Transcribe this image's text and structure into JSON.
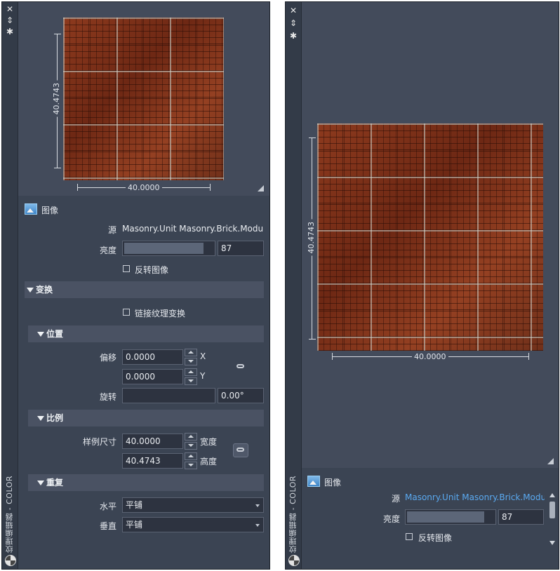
{
  "left_panel": {
    "palette_title": "纹理编辑器 - COLOR",
    "preview": {
      "width_label": "40.0000",
      "height_label": "40.4743"
    },
    "image_section": {
      "heading": "图像",
      "source_label": "源",
      "source_value": "Masonry.Unit Masonry.Brick.Modu",
      "brightness_label": "亮度",
      "brightness_value": "87",
      "brightness_fraction": 0.87,
      "invert_label": "反转图像",
      "invert_checked": false
    },
    "transform": {
      "heading": "变换",
      "link_transforms_label": "链接纹理变换",
      "link_transforms_checked": false,
      "position": {
        "heading": "位置",
        "offset_label": "偏移",
        "offset_x": "0.0000",
        "x_axis": "X",
        "offset_y": "0.0000",
        "y_axis": "Y",
        "rotation_label": "旋转",
        "rotation_value": "0.00°"
      },
      "scale": {
        "heading": "比例",
        "sample_size_label": "样例尺寸",
        "width_value": "40.0000",
        "width_label": "宽度",
        "height_value": "40.4743",
        "height_label": "高度"
      },
      "repeat": {
        "heading": "重复",
        "horizontal_label": "水平",
        "horizontal_value": "平铺",
        "vertical_label": "垂直",
        "vertical_value": "平铺"
      }
    }
  },
  "right_panel": {
    "palette_title": "纹理编辑器 - COLOR",
    "preview": {
      "width_label": "40.0000",
      "height_label": "40.4743"
    },
    "image_section": {
      "heading": "图像",
      "source_label": "源",
      "source_value": "Masonry.Unit Masonry.Brick.Modu",
      "brightness_label": "亮度",
      "brightness_value": "87",
      "brightness_fraction": 0.87,
      "invert_label": "反转图像",
      "invert_checked": false
    }
  },
  "colors": {
    "panel_bg": "#3b4453",
    "preview_bg": "#434b5b",
    "section_bg": "#4a5263",
    "link_blue": "#5aa9f0"
  },
  "icons": [
    "close-icon",
    "pin-icon",
    "settings-icon",
    "image-icon",
    "link-icon",
    "app-icon"
  ]
}
